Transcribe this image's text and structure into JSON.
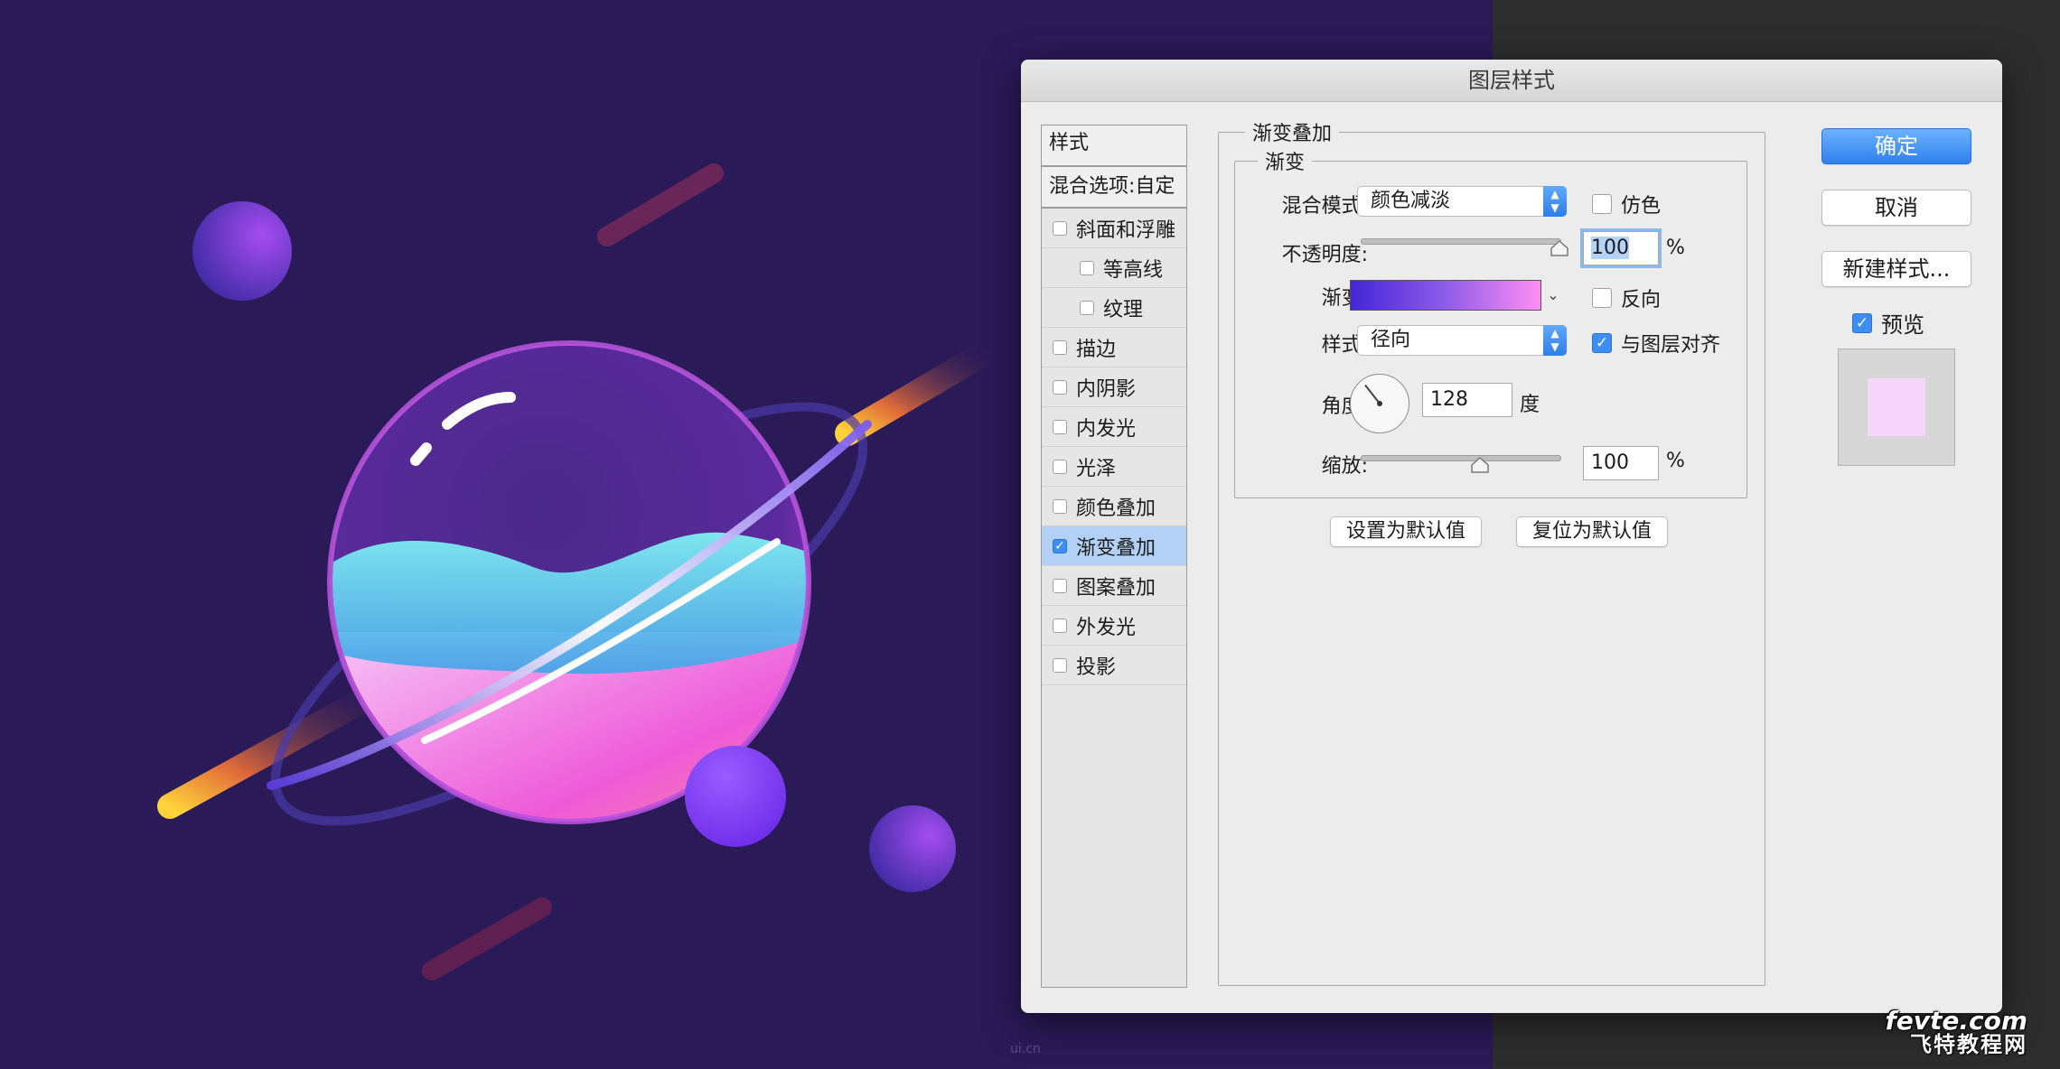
{
  "dialog": {
    "title": "图层样式",
    "styles_header": "样式",
    "blend_options": "混合选项:自定",
    "style_items": [
      {
        "label": "斜面和浮雕",
        "checked": false,
        "indent": false
      },
      {
        "label": "等高线",
        "checked": false,
        "indent": true
      },
      {
        "label": "纹理",
        "checked": false,
        "indent": true
      },
      {
        "label": "描边",
        "checked": false,
        "indent": false
      },
      {
        "label": "内阴影",
        "checked": false,
        "indent": false
      },
      {
        "label": "内发光",
        "checked": false,
        "indent": false
      },
      {
        "label": "光泽",
        "checked": false,
        "indent": false
      },
      {
        "label": "颜色叠加",
        "checked": false,
        "indent": false
      },
      {
        "label": "渐变叠加",
        "checked": true,
        "indent": false,
        "selected": true
      },
      {
        "label": "图案叠加",
        "checked": false,
        "indent": false
      },
      {
        "label": "外发光",
        "checked": false,
        "indent": false
      },
      {
        "label": "投影",
        "checked": false,
        "indent": false
      }
    ],
    "panel": {
      "section_title": "渐变叠加",
      "group_title": "渐变",
      "blend_mode_label": "混合模式:",
      "blend_mode_value": "颜色减淡",
      "dither_label": "仿色",
      "dither_checked": false,
      "opacity_label": "不透明度:",
      "opacity_value": "100",
      "opacity_unit": "%",
      "opacity_fraction": 1.0,
      "gradient_label": "渐变:",
      "gradient_colors": [
        "#4326d8",
        "#8f5ce8",
        "#ff8ef4"
      ],
      "reverse_label": "反向",
      "reverse_checked": false,
      "style_label": "样式:",
      "style_value": "径向",
      "align_label": "与图层对齐",
      "align_checked": true,
      "angle_label": "角度:",
      "angle_value": "128",
      "angle_unit": "度",
      "angle_degrees": 128,
      "scale_label": "缩放:",
      "scale_value": "100",
      "scale_unit": "%",
      "scale_fraction": 0.6,
      "reset_default_button": "设置为默认值",
      "restore_default_button": "复位为默认值"
    },
    "ok_button": "确定",
    "cancel_button": "取消",
    "new_style_button": "新建样式...",
    "preview_label": "预览",
    "preview_checked": true,
    "preview_color": "#f7d6fb"
  },
  "watermarks": {
    "small": "ui.cn",
    "brand_line1": "fevte.com",
    "brand_line2": "飞特教程网"
  },
  "colors": {
    "canvas_bg": "#2a1a58",
    "accent_blue": "#3d8ef2"
  }
}
